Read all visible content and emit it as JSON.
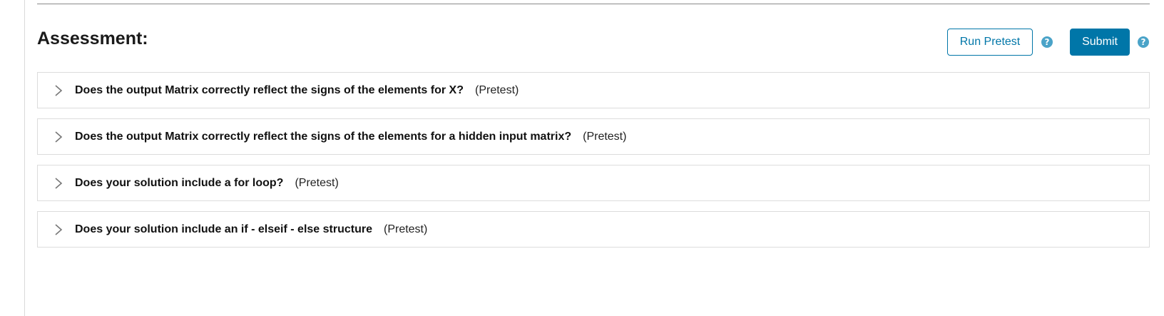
{
  "section": {
    "title": "Assessment:"
  },
  "actions": {
    "run_pretest_label": "Run Pretest",
    "submit_label": "Submit",
    "help_glyph": "?"
  },
  "tests": [
    {
      "question": "Does the output Matrix correctly reflect the signs of the elements for X?",
      "tag": "(Pretest)"
    },
    {
      "question": "Does the output Matrix correctly reflect the signs of the elements for a hidden input matrix?",
      "tag": "(Pretest)"
    },
    {
      "question": "Does your solution include a for loop?",
      "tag": "(Pretest)"
    },
    {
      "question": "Does your solution include an if - elseif - else structure",
      "tag": "(Pretest)"
    }
  ],
  "colors": {
    "accent": "#0076a8",
    "help_icon": "#4aa3c8",
    "border": "#dcdcdc"
  },
  "icons": {
    "expand": "chevron-right-icon",
    "help": "question-circle-icon"
  }
}
